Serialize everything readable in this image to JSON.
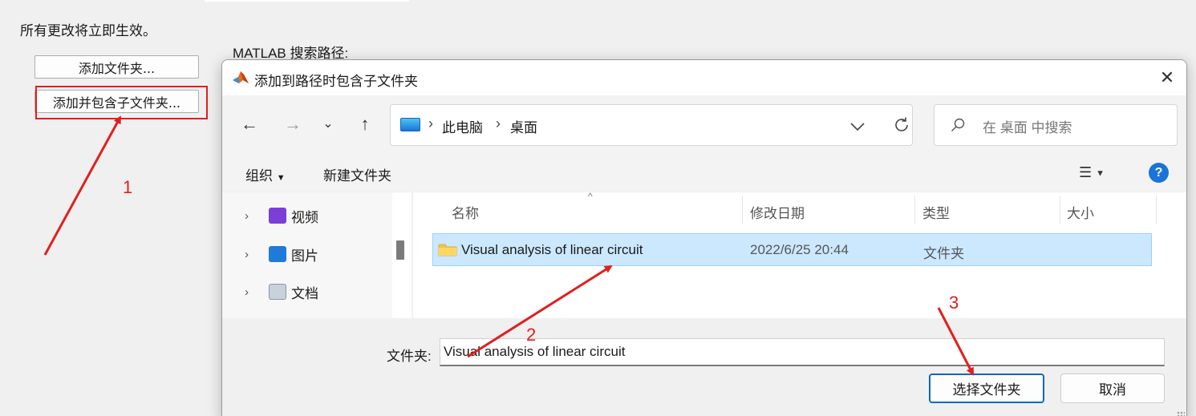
{
  "background": {
    "notice": "所有更改将立即生效。",
    "add_folder_button": "添加文件夹...",
    "add_with_subfolders_button": "添加并包含子文件夹...",
    "search_path_label": "MATLAB 搜索路径:"
  },
  "dialog": {
    "title": "添加到路径时包含子文件夹",
    "close_label": "✕",
    "nav": {
      "back": "←",
      "forward": "→",
      "recent": "⌄",
      "up": "↑"
    },
    "breadcrumb": [
      "此电脑",
      "桌面"
    ],
    "breadcrumb_separator": "›",
    "search_placeholder": "在 桌面 中搜索",
    "toolbar": {
      "organize": "组织",
      "new_folder": "新建文件夹",
      "help": "?"
    },
    "tree": [
      {
        "label": "视频",
        "icon": "video-icon",
        "color": "#7b3fd6"
      },
      {
        "label": "图片",
        "icon": "picture-icon",
        "color": "#1f7ad8"
      },
      {
        "label": "文档",
        "icon": "document-icon",
        "color": "#8a97a8"
      }
    ],
    "columns": {
      "name": "名称",
      "modified": "修改日期",
      "type": "类型",
      "size": "大小"
    },
    "files": [
      {
        "name": "Visual analysis of linear circuit",
        "modified": "2022/6/25 20:44",
        "type": "文件夹",
        "size": ""
      }
    ],
    "folder_label": "文件夹:",
    "folder_value": "Visual analysis of linear circuit",
    "select_button": "选择文件夹",
    "cancel_button": "取消"
  },
  "annotations": {
    "color": "#e0201e",
    "labels": [
      "1",
      "2",
      "3"
    ]
  }
}
